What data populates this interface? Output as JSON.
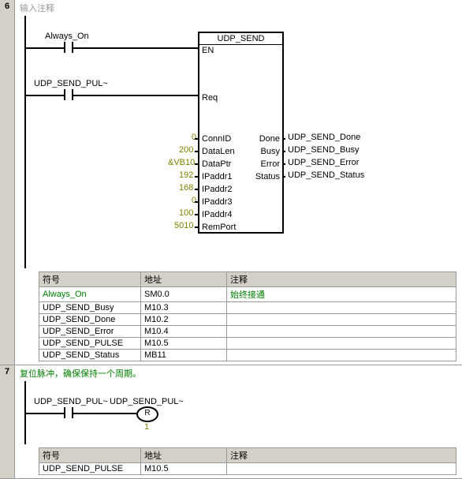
{
  "net6": {
    "num": "6",
    "comment": "输入注释",
    "contact1": "Always_On",
    "contact2": "UDP_SEND_PUL~",
    "block": {
      "title": "UDP_SEND",
      "inputs": [
        {
          "v": "",
          "name": "EN"
        },
        {
          "v": "",
          "name": "Req"
        },
        {
          "v": "0",
          "name": "ConnID"
        },
        {
          "v": "200",
          "name": "DataLen"
        },
        {
          "v": "&VB10",
          "name": "DataPtr"
        },
        {
          "v": "192",
          "name": "IPaddr1"
        },
        {
          "v": "168",
          "name": "IPaddr2"
        },
        {
          "v": "0",
          "name": "IPaddr3"
        },
        {
          "v": "100",
          "name": "IPaddr4"
        },
        {
          "v": "5010",
          "name": "RemPort"
        }
      ],
      "outputs": [
        {
          "name": "Done",
          "v": "UDP_SEND_Done"
        },
        {
          "name": "Busy",
          "v": "UDP_SEND_Busy"
        },
        {
          "name": "Error",
          "v": "UDP_SEND_Error"
        },
        {
          "name": "Status",
          "v": "UDP_SEND_Status"
        }
      ]
    },
    "table": {
      "headers": [
        "符号",
        "地址",
        "注释"
      ],
      "rows": [
        [
          "Always_On",
          "SM0.0",
          "始终接通"
        ],
        [
          "UDP_SEND_Busy",
          "M10.3",
          ""
        ],
        [
          "UDP_SEND_Done",
          "M10.2",
          ""
        ],
        [
          "UDP_SEND_Error",
          "M10.4",
          ""
        ],
        [
          "UDP_SEND_PULSE",
          "M10.5",
          ""
        ],
        [
          "UDP_SEND_Status",
          "MB11",
          ""
        ]
      ]
    }
  },
  "net7": {
    "num": "7",
    "comment": "复位脉冲，确保保持一个周期。",
    "contact1": "UDP_SEND_PUL~",
    "coil_label": "UDP_SEND_PUL~",
    "coil_type": "R",
    "coil_count": "1",
    "table": {
      "headers": [
        "符号",
        "地址",
        "注释"
      ],
      "rows": [
        [
          "UDP_SEND_PULSE",
          "M10.5",
          ""
        ]
      ]
    }
  }
}
